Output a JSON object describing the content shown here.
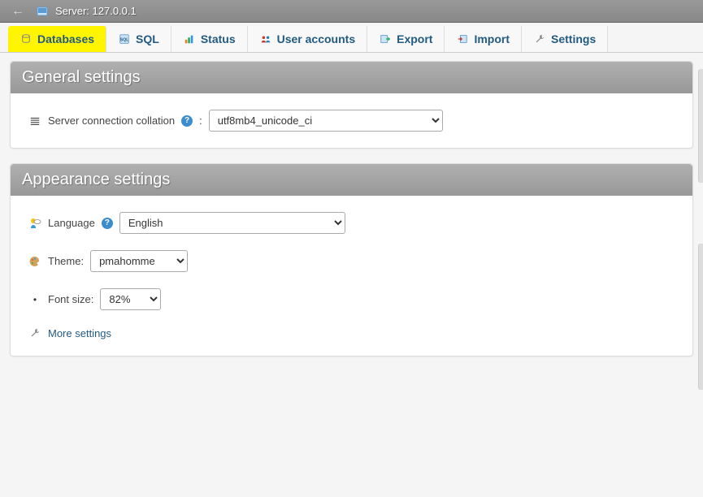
{
  "topbar": {
    "server_label": "Server: 127.0.0.1"
  },
  "tabs": {
    "databases": "Databases",
    "sql": "SQL",
    "status": "Status",
    "user_accounts": "User accounts",
    "export": "Export",
    "import": "Import",
    "settings": "Settings"
  },
  "general": {
    "title": "General settings",
    "collation_label": "Server connection collation",
    "collation_value": "utf8mb4_unicode_ci"
  },
  "appearance": {
    "title": "Appearance settings",
    "language_label": "Language",
    "language_value": "English",
    "theme_label": "Theme:",
    "theme_value": "pmahomme",
    "fontsize_label": "Font size:",
    "fontsize_value": "82%",
    "more_settings": "More settings"
  }
}
